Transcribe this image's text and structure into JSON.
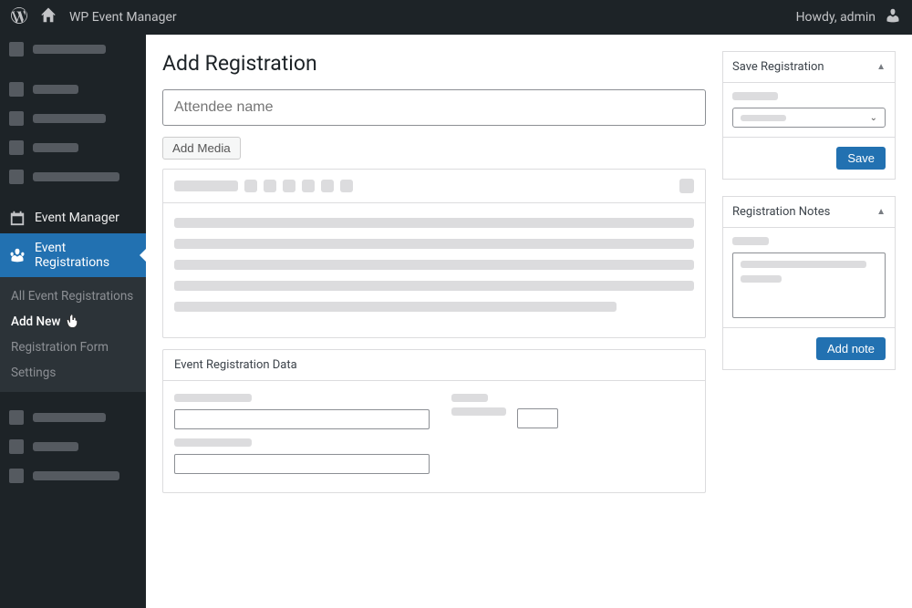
{
  "adminbar": {
    "site_title": "WP Event Manager",
    "greeting": "Howdy, admin"
  },
  "sidebar": {
    "event_manager": "Event Manager",
    "event_registrations": "Event Registrations",
    "submenu": {
      "all": "All Event Registrations",
      "add_new": "Add New",
      "form": "Registration Form",
      "settings": "Settings"
    }
  },
  "page": {
    "title": "Add Registration",
    "attendee_placeholder": "Attendee name",
    "add_media": "Add Media",
    "erd_title": "Event Registration Data"
  },
  "panels": {
    "save": {
      "title": "Save Registration",
      "button": "Save"
    },
    "notes": {
      "title": "Registration Notes",
      "button": "Add note"
    }
  }
}
